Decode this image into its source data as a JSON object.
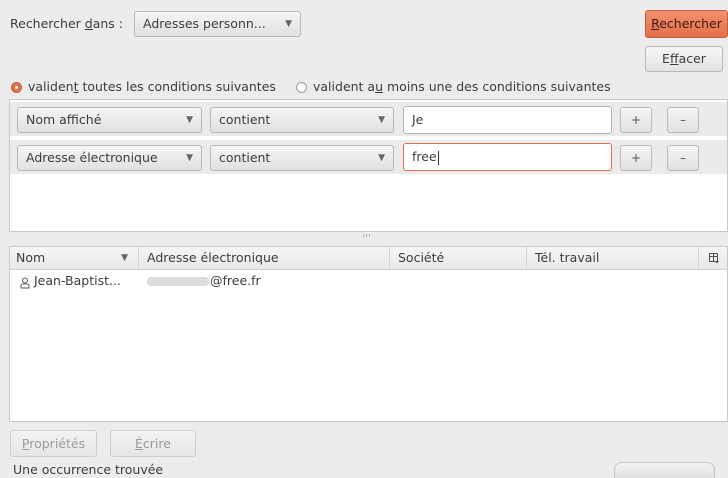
{
  "search_in": {
    "label": "Rechercher dans :",
    "label_pre": "Rechercher ",
    "label_underlined": "d",
    "label_post": "ans :",
    "value": "Adresses personn..."
  },
  "buttons": {
    "rechercher_u": "R",
    "rechercher_rest": "echercher",
    "effacer_pre": "E",
    "effacer_u": "f",
    "effacer_post": "facer",
    "proprietes_u": "P",
    "proprietes_rest": "ropriétés",
    "ecrire_u": "É",
    "ecrire_rest": "crire"
  },
  "match_mode": {
    "all_pre": "validen",
    "all_u": "t",
    "all_post": " toutes les conditions suivantes",
    "any_pre": "valident a",
    "any_u": "u",
    "any_post": " moins une des conditions suivantes",
    "selected": "all"
  },
  "rules": [
    {
      "field": "Nom affiché",
      "operator": "contient",
      "value": "Je",
      "add": "+",
      "remove": "–"
    },
    {
      "field": "Adresse électronique",
      "operator": "contient",
      "value": "free",
      "add": "+",
      "remove": "–"
    }
  ],
  "results": {
    "columns": [
      "Nom",
      "Adresse électronique",
      "Société",
      "Tél. travail"
    ],
    "rows": [
      {
        "name": "Jean-Baptist...",
        "email": "@free.fr",
        "company": "",
        "phone": ""
      }
    ]
  },
  "status": "Une occurrence trouvée",
  "colors": {
    "accent": "#e4704a",
    "selected_radio": "#e4704a"
  }
}
